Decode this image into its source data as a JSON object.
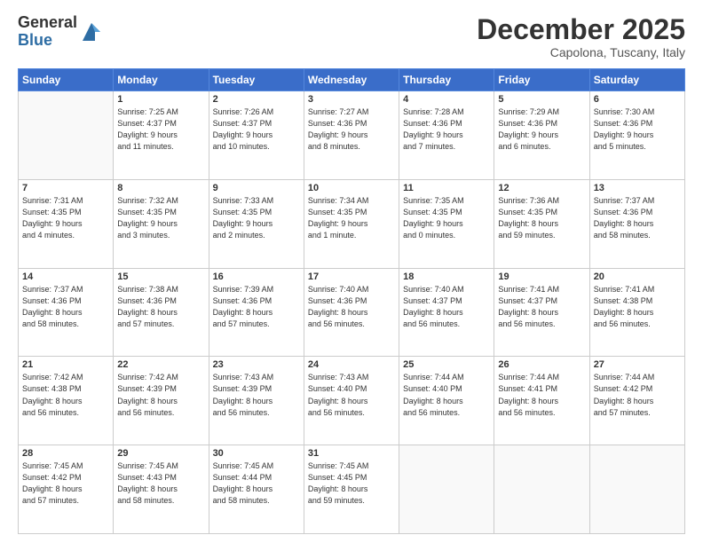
{
  "logo": {
    "general": "General",
    "blue": "Blue"
  },
  "header": {
    "month": "December 2025",
    "location": "Capolona, Tuscany, Italy"
  },
  "days_of_week": [
    "Sunday",
    "Monday",
    "Tuesday",
    "Wednesday",
    "Thursday",
    "Friday",
    "Saturday"
  ],
  "weeks": [
    [
      {
        "num": "",
        "info": ""
      },
      {
        "num": "1",
        "info": "Sunrise: 7:25 AM\nSunset: 4:37 PM\nDaylight: 9 hours\nand 11 minutes."
      },
      {
        "num": "2",
        "info": "Sunrise: 7:26 AM\nSunset: 4:37 PM\nDaylight: 9 hours\nand 10 minutes."
      },
      {
        "num": "3",
        "info": "Sunrise: 7:27 AM\nSunset: 4:36 PM\nDaylight: 9 hours\nand 8 minutes."
      },
      {
        "num": "4",
        "info": "Sunrise: 7:28 AM\nSunset: 4:36 PM\nDaylight: 9 hours\nand 7 minutes."
      },
      {
        "num": "5",
        "info": "Sunrise: 7:29 AM\nSunset: 4:36 PM\nDaylight: 9 hours\nand 6 minutes."
      },
      {
        "num": "6",
        "info": "Sunrise: 7:30 AM\nSunset: 4:36 PM\nDaylight: 9 hours\nand 5 minutes."
      }
    ],
    [
      {
        "num": "7",
        "info": "Sunrise: 7:31 AM\nSunset: 4:35 PM\nDaylight: 9 hours\nand 4 minutes."
      },
      {
        "num": "8",
        "info": "Sunrise: 7:32 AM\nSunset: 4:35 PM\nDaylight: 9 hours\nand 3 minutes."
      },
      {
        "num": "9",
        "info": "Sunrise: 7:33 AM\nSunset: 4:35 PM\nDaylight: 9 hours\nand 2 minutes."
      },
      {
        "num": "10",
        "info": "Sunrise: 7:34 AM\nSunset: 4:35 PM\nDaylight: 9 hours\nand 1 minute."
      },
      {
        "num": "11",
        "info": "Sunrise: 7:35 AM\nSunset: 4:35 PM\nDaylight: 9 hours\nand 0 minutes."
      },
      {
        "num": "12",
        "info": "Sunrise: 7:36 AM\nSunset: 4:35 PM\nDaylight: 8 hours\nand 59 minutes."
      },
      {
        "num": "13",
        "info": "Sunrise: 7:37 AM\nSunset: 4:36 PM\nDaylight: 8 hours\nand 58 minutes."
      }
    ],
    [
      {
        "num": "14",
        "info": "Sunrise: 7:37 AM\nSunset: 4:36 PM\nDaylight: 8 hours\nand 58 minutes."
      },
      {
        "num": "15",
        "info": "Sunrise: 7:38 AM\nSunset: 4:36 PM\nDaylight: 8 hours\nand 57 minutes."
      },
      {
        "num": "16",
        "info": "Sunrise: 7:39 AM\nSunset: 4:36 PM\nDaylight: 8 hours\nand 57 minutes."
      },
      {
        "num": "17",
        "info": "Sunrise: 7:40 AM\nSunset: 4:36 PM\nDaylight: 8 hours\nand 56 minutes."
      },
      {
        "num": "18",
        "info": "Sunrise: 7:40 AM\nSunset: 4:37 PM\nDaylight: 8 hours\nand 56 minutes."
      },
      {
        "num": "19",
        "info": "Sunrise: 7:41 AM\nSunset: 4:37 PM\nDaylight: 8 hours\nand 56 minutes."
      },
      {
        "num": "20",
        "info": "Sunrise: 7:41 AM\nSunset: 4:38 PM\nDaylight: 8 hours\nand 56 minutes."
      }
    ],
    [
      {
        "num": "21",
        "info": "Sunrise: 7:42 AM\nSunset: 4:38 PM\nDaylight: 8 hours\nand 56 minutes."
      },
      {
        "num": "22",
        "info": "Sunrise: 7:42 AM\nSunset: 4:39 PM\nDaylight: 8 hours\nand 56 minutes."
      },
      {
        "num": "23",
        "info": "Sunrise: 7:43 AM\nSunset: 4:39 PM\nDaylight: 8 hours\nand 56 minutes."
      },
      {
        "num": "24",
        "info": "Sunrise: 7:43 AM\nSunset: 4:40 PM\nDaylight: 8 hours\nand 56 minutes."
      },
      {
        "num": "25",
        "info": "Sunrise: 7:44 AM\nSunset: 4:40 PM\nDaylight: 8 hours\nand 56 minutes."
      },
      {
        "num": "26",
        "info": "Sunrise: 7:44 AM\nSunset: 4:41 PM\nDaylight: 8 hours\nand 56 minutes."
      },
      {
        "num": "27",
        "info": "Sunrise: 7:44 AM\nSunset: 4:42 PM\nDaylight: 8 hours\nand 57 minutes."
      }
    ],
    [
      {
        "num": "28",
        "info": "Sunrise: 7:45 AM\nSunset: 4:42 PM\nDaylight: 8 hours\nand 57 minutes."
      },
      {
        "num": "29",
        "info": "Sunrise: 7:45 AM\nSunset: 4:43 PM\nDaylight: 8 hours\nand 58 minutes."
      },
      {
        "num": "30",
        "info": "Sunrise: 7:45 AM\nSunset: 4:44 PM\nDaylight: 8 hours\nand 58 minutes."
      },
      {
        "num": "31",
        "info": "Sunrise: 7:45 AM\nSunset: 4:45 PM\nDaylight: 8 hours\nand 59 minutes."
      },
      {
        "num": "",
        "info": ""
      },
      {
        "num": "",
        "info": ""
      },
      {
        "num": "",
        "info": ""
      }
    ]
  ]
}
